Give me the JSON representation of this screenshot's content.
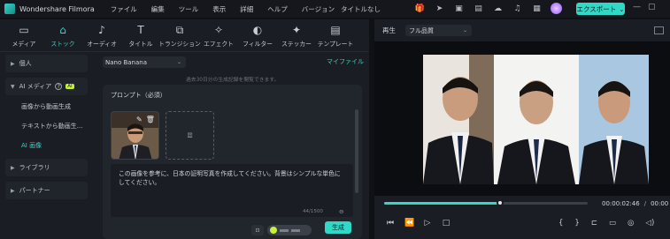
{
  "app": {
    "name": "Wondershare Filmora",
    "doc_title": "タイトルなし"
  },
  "menu": [
    "ファイル",
    "編集",
    "ツール",
    "表示",
    "詳細",
    "ヘルプ",
    "バージョン"
  ],
  "export_label": "エクスポート",
  "toolbar": [
    {
      "label": "メディア",
      "icon": "media-icon"
    },
    {
      "label": "ストック",
      "icon": "stock-icon",
      "active": true
    },
    {
      "label": "オーディオ",
      "icon": "audio-icon"
    },
    {
      "label": "タイトル",
      "icon": "title-icon"
    },
    {
      "label": "トランジション",
      "icon": "transition-icon"
    },
    {
      "label": "エフェクト",
      "icon": "effect-icon"
    },
    {
      "label": "フィルター",
      "icon": "filter-icon"
    },
    {
      "label": "ステッカー",
      "icon": "sticker-icon"
    },
    {
      "label": "テンプレート",
      "icon": "template-icon"
    }
  ],
  "sidebar": {
    "personal": "個人",
    "ai_media": "AI メディア",
    "ai_badge": "AI",
    "ai_items": [
      "画像から動画生成",
      "テキストから動画生...",
      "AI 画像"
    ],
    "library": "ライブラリ",
    "partner": "パートナー"
  },
  "content": {
    "model": "Nano Banana",
    "my_files": "マイファイル",
    "notice": "過去30日分の生成記録を閲覧できます。",
    "prompt_label": "プロンプト（必須）",
    "prompt_text": "この画像を参考に、日本の証明写真を作成してください。背景はシンプルな単色にしてください。",
    "counter": "44/1500",
    "generate_label": "生成"
  },
  "player": {
    "play_label": "再生",
    "quality": "フル品質",
    "progress_percent": 57,
    "time_current": "00:00:02:46",
    "time_total": "/",
    "time_total_value": "00:00"
  }
}
